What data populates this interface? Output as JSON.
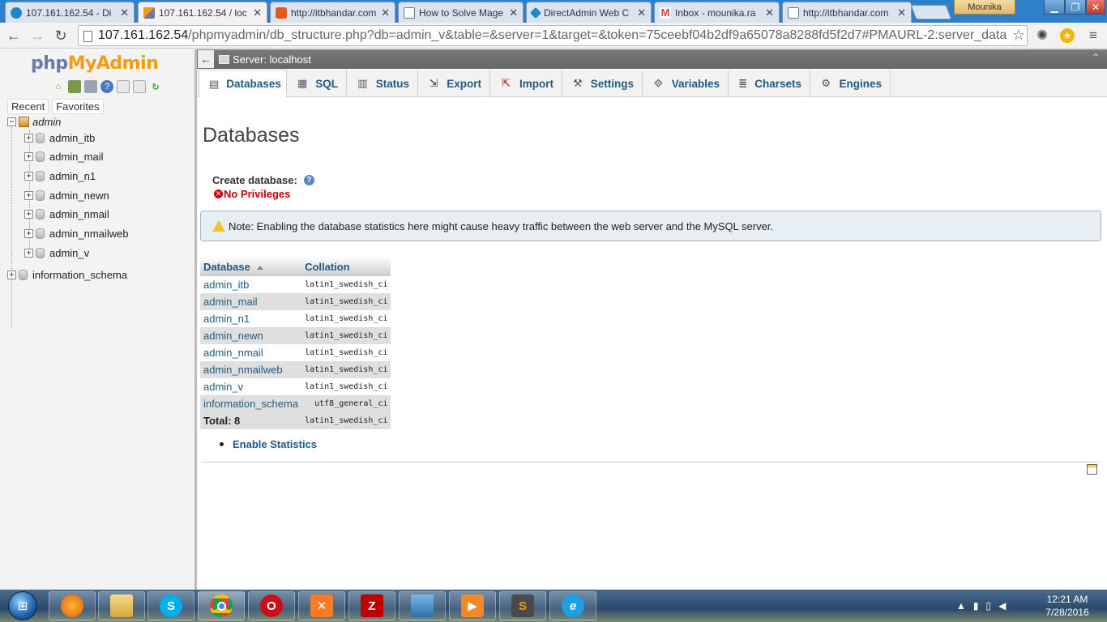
{
  "browser": {
    "tabs": [
      {
        "title": "107.161.162.54 - Di",
        "fav_color": "#1e88c9"
      },
      {
        "title": "107.161.162.54 / loc",
        "fav_color": "#f89c0e"
      },
      {
        "title": "http://itbhandar.com",
        "fav_color": "#e8561e"
      },
      {
        "title": "How to Solve Mage",
        "fav_color": "#ffffff"
      },
      {
        "title": "DirectAdmin Web C",
        "fav_color": "#1e88c9"
      },
      {
        "title": "Inbox - mounika.ra",
        "fav_color": "#d44638"
      },
      {
        "title": "http://itbhandar.com",
        "fav_color": "#ffffff"
      }
    ],
    "profile_name": "Mounika",
    "url_host": "107.161.162.54",
    "url_rest": "/phpmyadmin/db_structure.php?db=admin_v&table=&server=1&target=&token=75ceebf04b2df9a65078a8288fd5f2d7#PMAURL-2:server_data"
  },
  "pma": {
    "logo_php": "php",
    "logo_myadmin": "MyAdmin",
    "recent_label": "Recent",
    "favorites_label": "Favorites",
    "tree": {
      "server_label": "admin",
      "databases": [
        "admin_itb",
        "admin_mail",
        "admin_n1",
        "admin_newn",
        "admin_nmail",
        "admin_nmailweb",
        "admin_v"
      ],
      "root_databases": [
        "information_schema"
      ]
    },
    "server_bar": "Server: localhost",
    "tabs": [
      {
        "label": "Databases",
        "icon": "databases-icon"
      },
      {
        "label": "SQL",
        "icon": "sql-icon"
      },
      {
        "label": "Status",
        "icon": "status-icon"
      },
      {
        "label": "Export",
        "icon": "export-icon"
      },
      {
        "label": "Import",
        "icon": "import-icon"
      },
      {
        "label": "Settings",
        "icon": "wrench-icon"
      },
      {
        "label": "Variables",
        "icon": "variables-icon"
      },
      {
        "label": "Charsets",
        "icon": "charsets-icon"
      },
      {
        "label": "Engines",
        "icon": "engines-icon"
      }
    ],
    "page_title": "Databases",
    "create_db_label": "Create database:",
    "no_privileges": "No Privileges",
    "note": "Note: Enabling the database statistics here might cause heavy traffic between the web server and the MySQL server.",
    "table": {
      "col_database": "Database",
      "col_collation": "Collation",
      "rows": [
        {
          "name": "admin_itb",
          "collation": "latin1_swedish_ci"
        },
        {
          "name": "admin_mail",
          "collation": "latin1_swedish_ci"
        },
        {
          "name": "admin_n1",
          "collation": "latin1_swedish_ci"
        },
        {
          "name": "admin_newn",
          "collation": "latin1_swedish_ci"
        },
        {
          "name": "admin_nmail",
          "collation": "latin1_swedish_ci"
        },
        {
          "name": "admin_nmailweb",
          "collation": "latin1_swedish_ci"
        },
        {
          "name": "admin_v",
          "collation": "latin1_swedish_ci"
        },
        {
          "name": "information_schema",
          "collation": "utf8_general_ci"
        }
      ],
      "total_label": "Total: 8",
      "total_collation": "latin1_swedish_ci"
    },
    "enable_statistics": "Enable Statistics"
  },
  "taskbar": {
    "time": "12:21 AM",
    "date": "7/28/2016"
  },
  "colors": {
    "link": "#235a81",
    "error": "#cc0000",
    "note_bg": "#e7eef4"
  }
}
